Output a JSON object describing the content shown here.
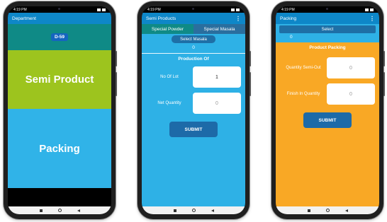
{
  "status_time": "4:19 PM",
  "screens": {
    "department": {
      "title": "Department",
      "badge": "D-59",
      "tile_semi": "Semi Product",
      "tile_packing": "Packing"
    },
    "semi_products": {
      "title": "Semi Products",
      "tab_powder": "Special Powder",
      "tab_masala": "Special Masala",
      "select_button": "Select Masala",
      "selected_value": "0",
      "section_title": "Production Of",
      "lot_label": "No Of Lot",
      "lot_value": "1",
      "net_label": "Net Quantity",
      "net_placeholder": "0",
      "submit": "SUBMIT"
    },
    "packing": {
      "title": "Packing",
      "select_button": "Select",
      "selected_value": "0",
      "section_title": "Product Packing",
      "qty_label": "Quantity Semi-Out",
      "qty_placeholder": "0",
      "finish_label": "Finish In Quantity",
      "finish_placeholder": "0",
      "submit": "SUBMIT"
    }
  },
  "colors": {
    "appbar": "#0e87c8",
    "teal": "#0f8a86",
    "green": "#9dc41e",
    "sky": "#30b3e8",
    "orange": "#f9a825",
    "button": "#1d6aa8"
  }
}
